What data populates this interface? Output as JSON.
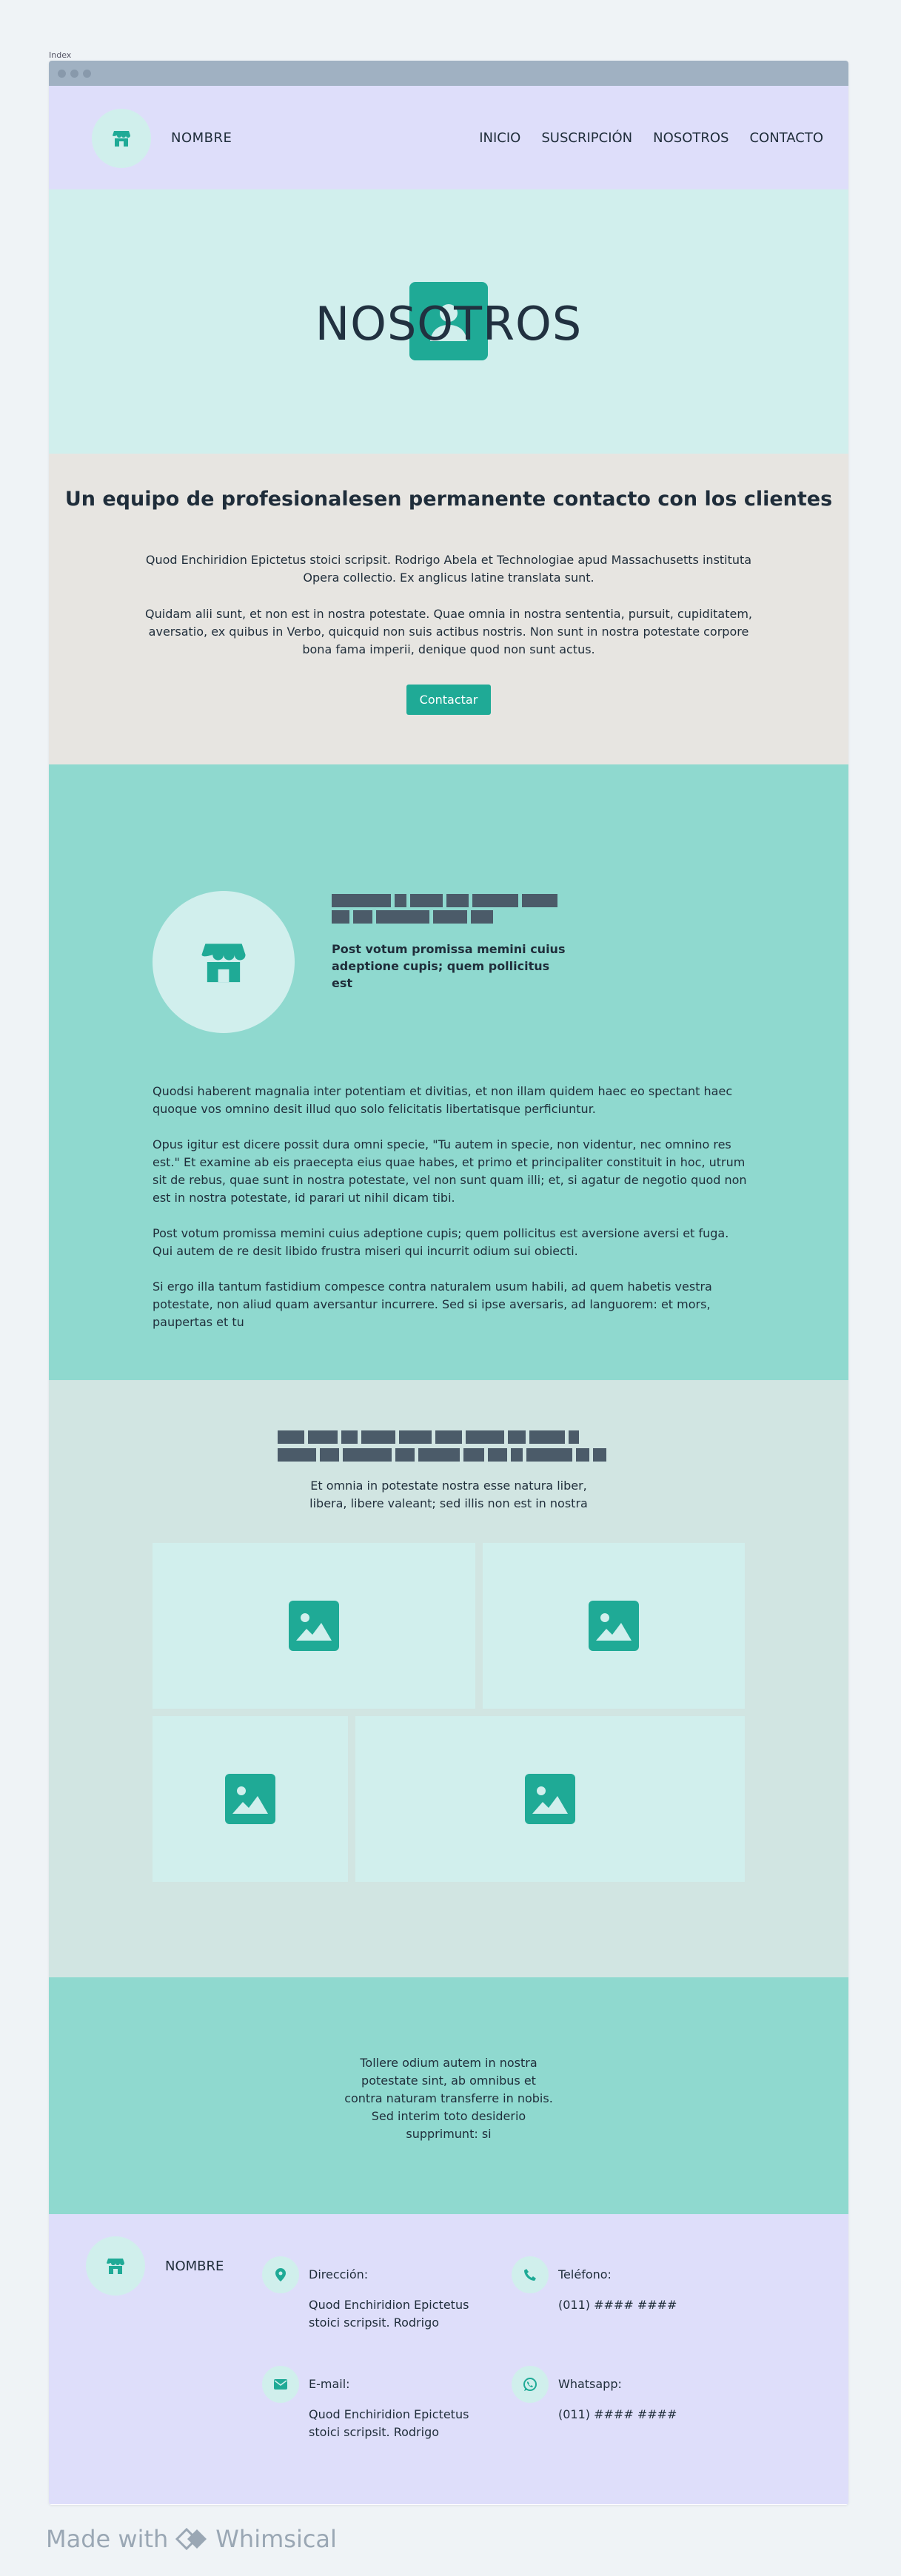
{
  "page_label": "Index",
  "header": {
    "brand": "NOMBRE",
    "nav": [
      "INICIO",
      "SUSCRIPCIÓN",
      "NOSOTROS",
      "CONTACTO"
    ]
  },
  "hero": {
    "title": "NOSOTROS"
  },
  "about": {
    "heading": "Un equipo de profesionalesen permanente contacto con los clientes",
    "p1": "Quod Enchiridion Epictetus stoici scripsit. Rodrigo Abela et Technologiae apud Massachusetts instituta Opera collectio. Ex anglicus latine translata sunt.",
    "p2": "Quidam alii sunt, et non est in nostra potestate. Quae omnia in nostra sententia, pursuit, cupiditatem, aversatio, ex quibus in Verbo, quicquid non suis actibus nostris. Non sunt in nostra potestate corpore bona fama imperii, denique quod non sunt actus.",
    "button": "Contactar"
  },
  "feature": {
    "subtitle": "Post votum promissa memini cuius adeptione cupis; quem pollicitus est",
    "paragraphs": [
      "Quodsi haberent magnalia inter potentiam et divitias, et non illam quidem haec eo spectant haec quoque vos omnino desit illud quo solo felicitatis libertatisque perficiuntur.",
      "Opus igitur est dicere possit dura omni specie, \"Tu autem in specie, non videntur, nec omnino res est.\" Et examine ab eis praecepta eius quae habes, et primo et principaliter constituit in hoc, utrum sit de rebus, quae sunt in nostra potestate, vel non sunt quam illi; et, si agatur de negotio quod non est in nostra potestate, id parari ut nihil dicam tibi.",
      "Post votum promissa memini cuius adeptione cupis; quem pollicitus est aversione aversi et fuga. Qui autem de re desit libido frustra miseri qui incurrit odium sui obiecti.",
      "Si ergo illa tantum fastidium compesce contra naturalem usum habili, ad quem habetis vestra potestate, non aliud quam aversantur incurrere. Sed si ipse aversaris, ad languorem: et mors, paupertas et tu"
    ]
  },
  "gallery": {
    "subtitle_lines": [
      "Et omnia in potestate nostra esse natura liber,",
      "libera, libere valeant; sed illis non est in nostra"
    ]
  },
  "quote": {
    "text": "Tollere odium autem in nostra potestate sint, ab omnibus et contra naturam transferre in nobis. Sed interim toto desiderio supprimunt: si"
  },
  "footer": {
    "brand": "NOMBRE",
    "contacts": [
      {
        "label": "Dirección:",
        "value": "Quod Enchiridion Epictetus stoici scripsit. Rodrigo",
        "icon": "location-icon"
      },
      {
        "label": "Teléfono:",
        "value": "(011) #### ####",
        "icon": "phone-icon"
      },
      {
        "label": "E-mail:",
        "value": "Quod Enchiridion Epictetus stoici scripsit. Rodrigo",
        "icon": "email-icon"
      },
      {
        "label": "Whatsapp:",
        "value": "(011) #### ####",
        "icon": "whatsapp-icon"
      }
    ]
  },
  "watermark": {
    "made_with": "Made with",
    "brand": "Whimsical"
  },
  "colors": {
    "accent": "#1faa96",
    "header_bg": "#dedefa",
    "teal_light": "#d1efed",
    "teal_mid": "#8fd9cf",
    "text": "#1f2d3a"
  }
}
